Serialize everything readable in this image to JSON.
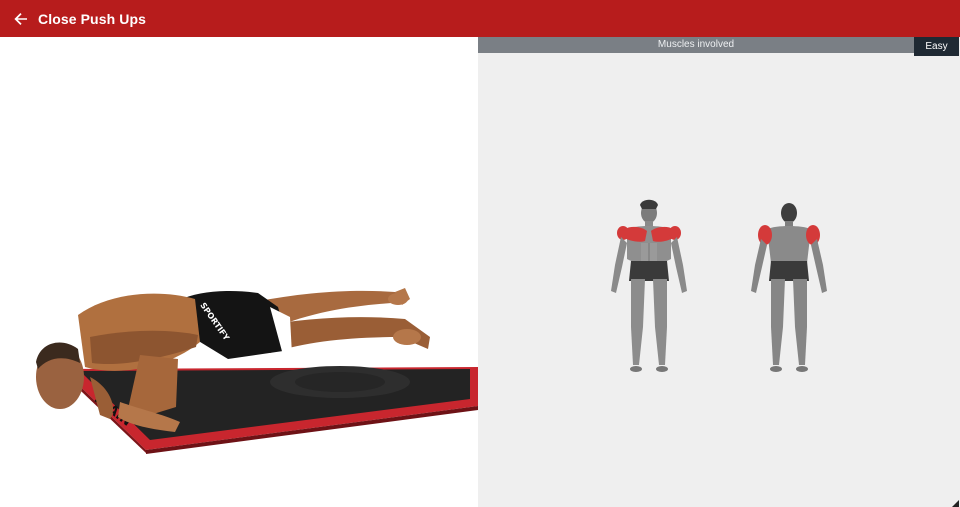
{
  "app_bar": {
    "title": "Close Push Ups",
    "back_icon": "arrow-back-icon",
    "color": "#b71c1c"
  },
  "exercise_animation": {
    "shorts_text": "SPORTIFY",
    "mat_text": "TRAIN"
  },
  "muscles_panel": {
    "header": "Muscles involved",
    "difficulty": "Easy",
    "highlight_color": "#d43a3a"
  }
}
